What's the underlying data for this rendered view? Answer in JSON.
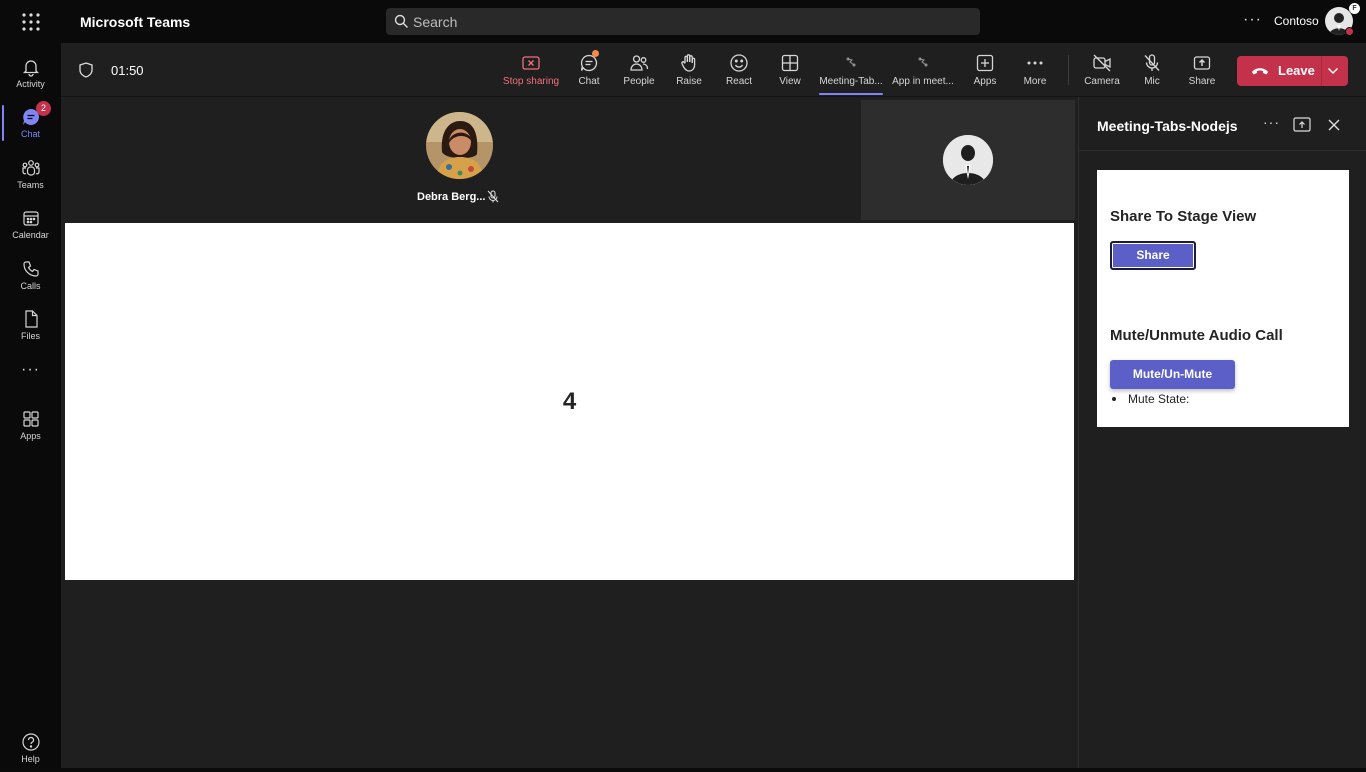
{
  "titlebar": {
    "app_title": "Microsoft Teams",
    "search_placeholder": "Search",
    "more": "···",
    "org_name": "Contoso",
    "avatar_badge": "F"
  },
  "rail": {
    "items": [
      {
        "label": "Activity",
        "icon": "bell-icon"
      },
      {
        "label": "Chat",
        "icon": "chat-icon",
        "badge": "2",
        "active": true
      },
      {
        "label": "Teams",
        "icon": "teams-icon"
      },
      {
        "label": "Calendar",
        "icon": "calendar-icon"
      },
      {
        "label": "Calls",
        "icon": "phone-icon"
      },
      {
        "label": "Files",
        "icon": "file-icon"
      },
      {
        "label": "Apps",
        "icon": "apps-icon"
      },
      {
        "label": "Help",
        "icon": "help-icon"
      }
    ],
    "more": "···"
  },
  "toolbar": {
    "timer": "01:50",
    "buttons": [
      {
        "label": "Stop sharing",
        "icon": "stop-sharing-icon"
      },
      {
        "label": "Chat",
        "icon": "chat-icon"
      },
      {
        "label": "People",
        "icon": "people-icon"
      },
      {
        "label": "Raise",
        "icon": "hand-icon"
      },
      {
        "label": "React",
        "icon": "smile-icon"
      },
      {
        "label": "View",
        "icon": "view-grid-icon"
      },
      {
        "label": "Meeting-Tab...",
        "icon": "app-icon"
      },
      {
        "label": "App in meet...",
        "icon": "app-icon"
      },
      {
        "label": "Apps",
        "icon": "plus-icon"
      },
      {
        "label": "More",
        "icon": "more-icon"
      },
      {
        "label": "Camera",
        "icon": "camera-off-icon"
      },
      {
        "label": "Mic",
        "icon": "mic-off-icon"
      },
      {
        "label": "Share",
        "icon": "share-tray-icon"
      }
    ],
    "leave_label": "Leave",
    "colors": {
      "leave": "#c4314b",
      "accent": "#7f85f5",
      "stop": "#f1707b"
    }
  },
  "stage": {
    "participant_name": "Debra Berg...",
    "shared_content": "4"
  },
  "panel": {
    "title": "Meeting-Tabs-Nodejs",
    "more": "···",
    "card": {
      "heading_share": "Share To Stage View",
      "share_button": "Share",
      "heading_mute": "Mute/Unmute Audio Call",
      "mute_button": "Mute/Un-Mute",
      "mute_state_label": "Mute State:"
    },
    "colors": {
      "button": "#5b5fc7"
    }
  }
}
